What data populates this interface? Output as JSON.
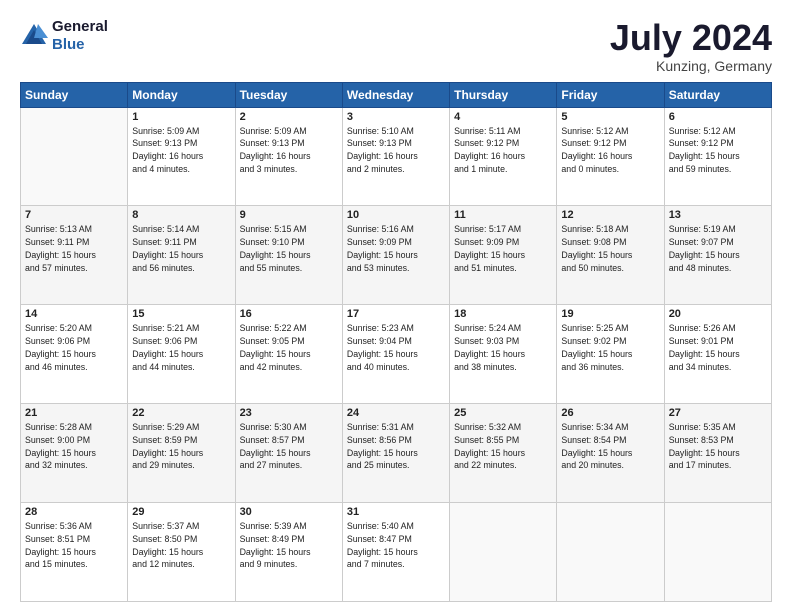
{
  "logo": {
    "line1": "General",
    "line2": "Blue"
  },
  "title": "July 2024",
  "location": "Kunzing, Germany",
  "headers": [
    "Sunday",
    "Monday",
    "Tuesday",
    "Wednesday",
    "Thursday",
    "Friday",
    "Saturday"
  ],
  "weeks": [
    [
      {
        "day": "",
        "info": ""
      },
      {
        "day": "1",
        "info": "Sunrise: 5:09 AM\nSunset: 9:13 PM\nDaylight: 16 hours\nand 4 minutes."
      },
      {
        "day": "2",
        "info": "Sunrise: 5:09 AM\nSunset: 9:13 PM\nDaylight: 16 hours\nand 3 minutes."
      },
      {
        "day": "3",
        "info": "Sunrise: 5:10 AM\nSunset: 9:13 PM\nDaylight: 16 hours\nand 2 minutes."
      },
      {
        "day": "4",
        "info": "Sunrise: 5:11 AM\nSunset: 9:12 PM\nDaylight: 16 hours\nand 1 minute."
      },
      {
        "day": "5",
        "info": "Sunrise: 5:12 AM\nSunset: 9:12 PM\nDaylight: 16 hours\nand 0 minutes."
      },
      {
        "day": "6",
        "info": "Sunrise: 5:12 AM\nSunset: 9:12 PM\nDaylight: 15 hours\nand 59 minutes."
      }
    ],
    [
      {
        "day": "7",
        "info": "Sunrise: 5:13 AM\nSunset: 9:11 PM\nDaylight: 15 hours\nand 57 minutes."
      },
      {
        "day": "8",
        "info": "Sunrise: 5:14 AM\nSunset: 9:11 PM\nDaylight: 15 hours\nand 56 minutes."
      },
      {
        "day": "9",
        "info": "Sunrise: 5:15 AM\nSunset: 9:10 PM\nDaylight: 15 hours\nand 55 minutes."
      },
      {
        "day": "10",
        "info": "Sunrise: 5:16 AM\nSunset: 9:09 PM\nDaylight: 15 hours\nand 53 minutes."
      },
      {
        "day": "11",
        "info": "Sunrise: 5:17 AM\nSunset: 9:09 PM\nDaylight: 15 hours\nand 51 minutes."
      },
      {
        "day": "12",
        "info": "Sunrise: 5:18 AM\nSunset: 9:08 PM\nDaylight: 15 hours\nand 50 minutes."
      },
      {
        "day": "13",
        "info": "Sunrise: 5:19 AM\nSunset: 9:07 PM\nDaylight: 15 hours\nand 48 minutes."
      }
    ],
    [
      {
        "day": "14",
        "info": "Sunrise: 5:20 AM\nSunset: 9:06 PM\nDaylight: 15 hours\nand 46 minutes."
      },
      {
        "day": "15",
        "info": "Sunrise: 5:21 AM\nSunset: 9:06 PM\nDaylight: 15 hours\nand 44 minutes."
      },
      {
        "day": "16",
        "info": "Sunrise: 5:22 AM\nSunset: 9:05 PM\nDaylight: 15 hours\nand 42 minutes."
      },
      {
        "day": "17",
        "info": "Sunrise: 5:23 AM\nSunset: 9:04 PM\nDaylight: 15 hours\nand 40 minutes."
      },
      {
        "day": "18",
        "info": "Sunrise: 5:24 AM\nSunset: 9:03 PM\nDaylight: 15 hours\nand 38 minutes."
      },
      {
        "day": "19",
        "info": "Sunrise: 5:25 AM\nSunset: 9:02 PM\nDaylight: 15 hours\nand 36 minutes."
      },
      {
        "day": "20",
        "info": "Sunrise: 5:26 AM\nSunset: 9:01 PM\nDaylight: 15 hours\nand 34 minutes."
      }
    ],
    [
      {
        "day": "21",
        "info": "Sunrise: 5:28 AM\nSunset: 9:00 PM\nDaylight: 15 hours\nand 32 minutes."
      },
      {
        "day": "22",
        "info": "Sunrise: 5:29 AM\nSunset: 8:59 PM\nDaylight: 15 hours\nand 29 minutes."
      },
      {
        "day": "23",
        "info": "Sunrise: 5:30 AM\nSunset: 8:57 PM\nDaylight: 15 hours\nand 27 minutes."
      },
      {
        "day": "24",
        "info": "Sunrise: 5:31 AM\nSunset: 8:56 PM\nDaylight: 15 hours\nand 25 minutes."
      },
      {
        "day": "25",
        "info": "Sunrise: 5:32 AM\nSunset: 8:55 PM\nDaylight: 15 hours\nand 22 minutes."
      },
      {
        "day": "26",
        "info": "Sunrise: 5:34 AM\nSunset: 8:54 PM\nDaylight: 15 hours\nand 20 minutes."
      },
      {
        "day": "27",
        "info": "Sunrise: 5:35 AM\nSunset: 8:53 PM\nDaylight: 15 hours\nand 17 minutes."
      }
    ],
    [
      {
        "day": "28",
        "info": "Sunrise: 5:36 AM\nSunset: 8:51 PM\nDaylight: 15 hours\nand 15 minutes."
      },
      {
        "day": "29",
        "info": "Sunrise: 5:37 AM\nSunset: 8:50 PM\nDaylight: 15 hours\nand 12 minutes."
      },
      {
        "day": "30",
        "info": "Sunrise: 5:39 AM\nSunset: 8:49 PM\nDaylight: 15 hours\nand 9 minutes."
      },
      {
        "day": "31",
        "info": "Sunrise: 5:40 AM\nSunset: 8:47 PM\nDaylight: 15 hours\nand 7 minutes."
      },
      {
        "day": "",
        "info": ""
      },
      {
        "day": "",
        "info": ""
      },
      {
        "day": "",
        "info": ""
      }
    ]
  ]
}
